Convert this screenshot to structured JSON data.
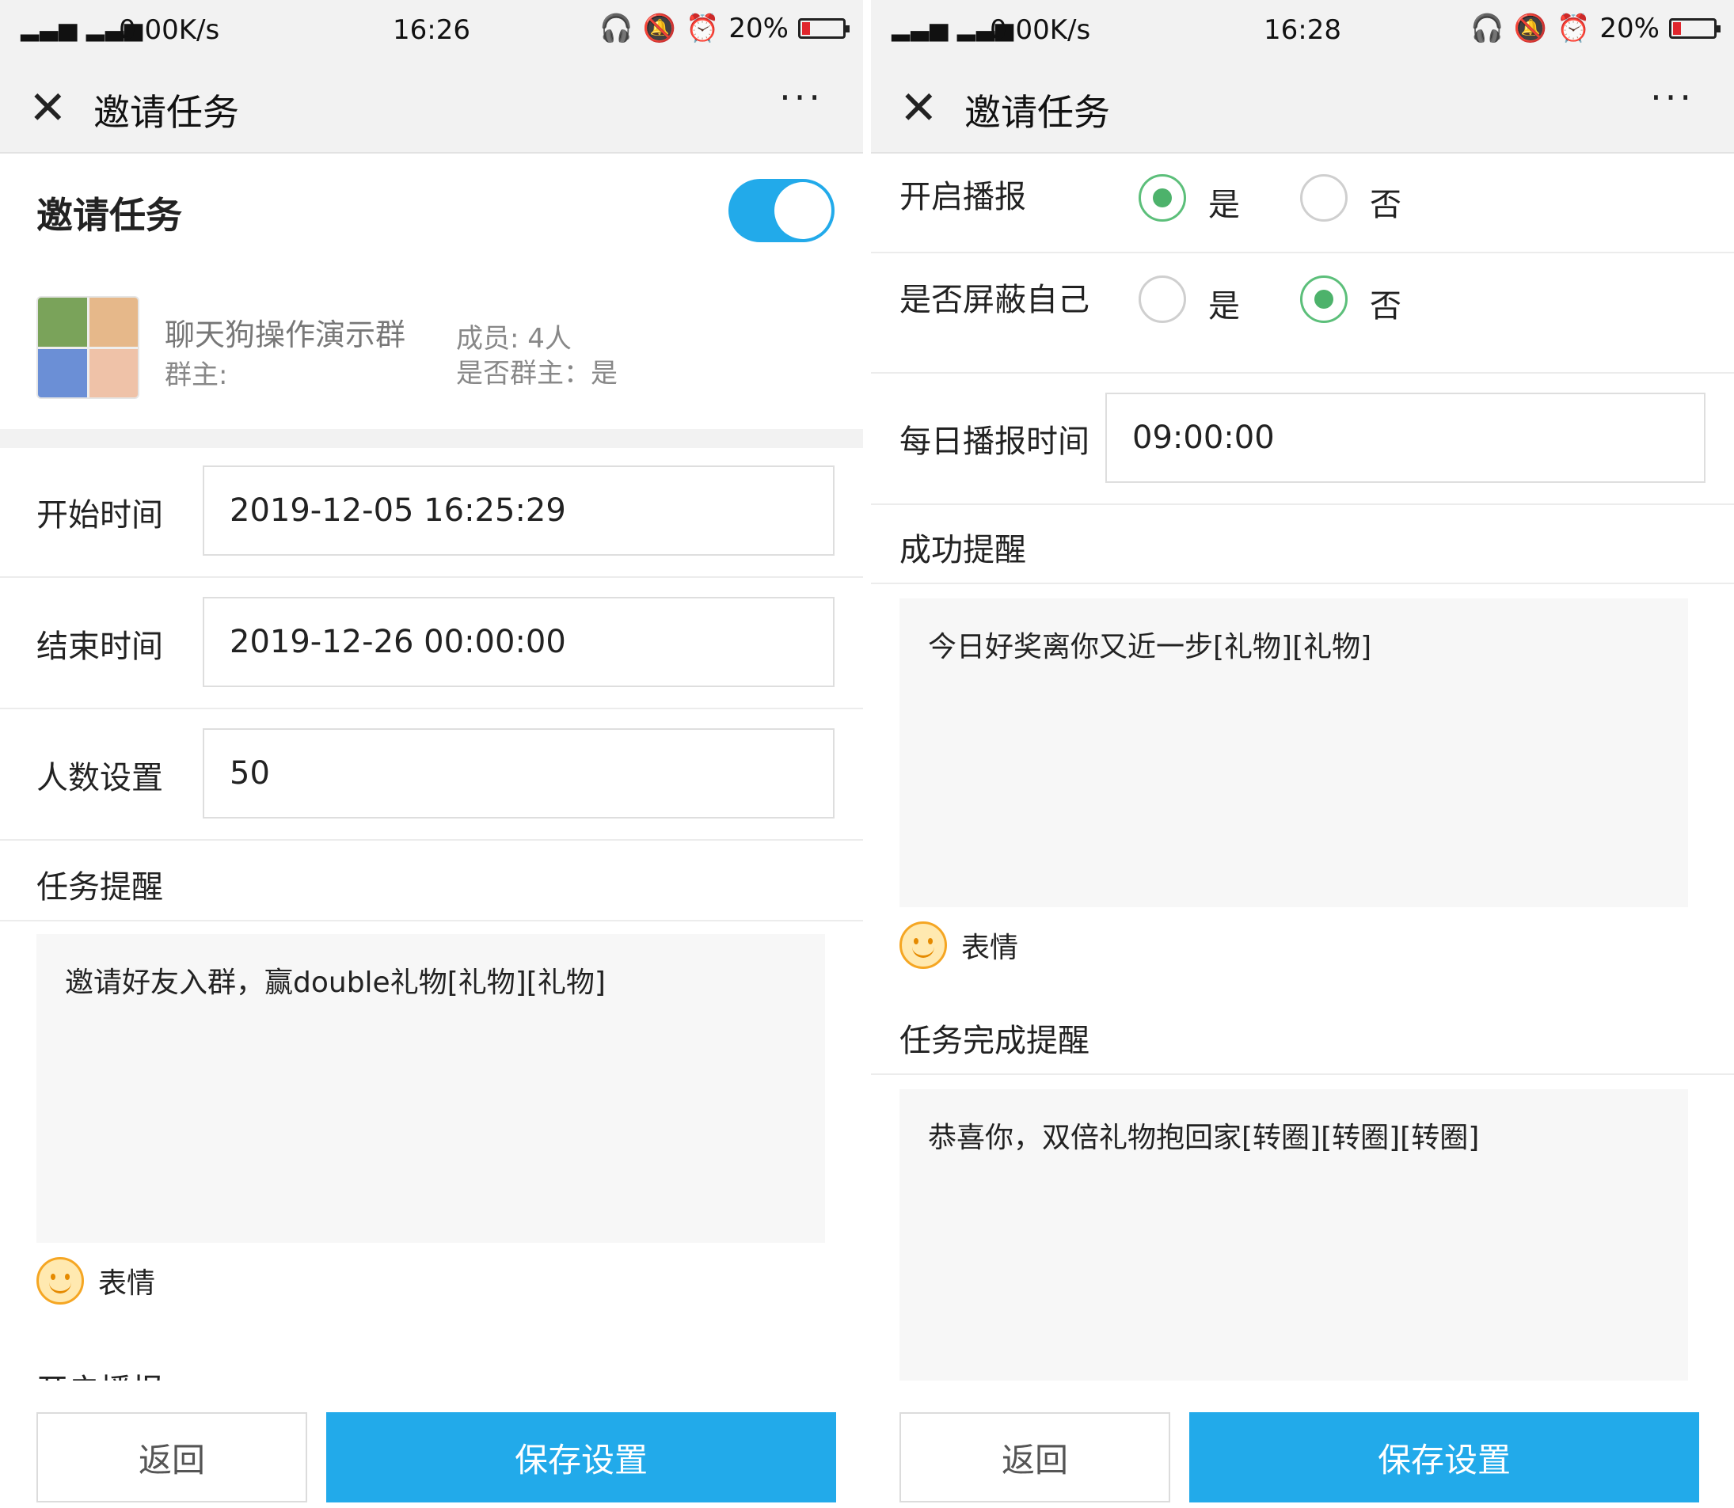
{
  "left": {
    "status": {
      "signal": "2G 4G 4G",
      "speed": "0.00K/s",
      "time": "16:26",
      "battery": "20%"
    },
    "nav": {
      "title": "邀请任务",
      "more": "···"
    },
    "section_title": "邀请任务",
    "toggle_on": true,
    "group": {
      "name": "聊天狗操作演示群",
      "owner_label": "群主:",
      "members": "成员: 4人",
      "is_owner": "是否群主：是"
    },
    "start_time": {
      "label": "开始时间",
      "value": "2019-12-05 16:25:29"
    },
    "end_time": {
      "label": "结束时间",
      "value": "2019-12-26 00:00:00"
    },
    "people": {
      "label": "人数设置",
      "value": "50"
    },
    "task_reminder": {
      "label": "任务提醒",
      "text": "邀请好友入群，赢double礼物[礼物][礼物]"
    },
    "emoji_label": "表情",
    "peek_label": "开启播报",
    "buttons": {
      "back": "返回",
      "save": "保存设置"
    }
  },
  "right": {
    "status": {
      "signal": "2G 4G 4G",
      "speed": "0.00K/s",
      "time": "16:28",
      "battery": "20%"
    },
    "nav": {
      "title": "邀请任务",
      "more": "···"
    },
    "broadcast": {
      "label": "开启播报",
      "yes": "是",
      "no": "否",
      "selected": "yes"
    },
    "hide_self": {
      "label": "是否屏蔽自己",
      "yes": "是",
      "no": "否",
      "selected": "no"
    },
    "daily_time": {
      "label": "每日播报时间",
      "value": "09:00:00"
    },
    "success_reminder": {
      "label": "成功提醒",
      "text": "今日好奖离你又近一步[礼物][礼物]"
    },
    "emoji_label": "表情",
    "complete_reminder": {
      "label": "任务完成提醒",
      "text": "恭喜你，双倍礼物抱回家[转圈][转圈][转圈]"
    },
    "buttons": {
      "back": "返回",
      "save": "保存设置"
    }
  },
  "colors": {
    "accent": "#22aaea",
    "radio_checked": "#4db26b",
    "battery_low": "#e0262d"
  }
}
